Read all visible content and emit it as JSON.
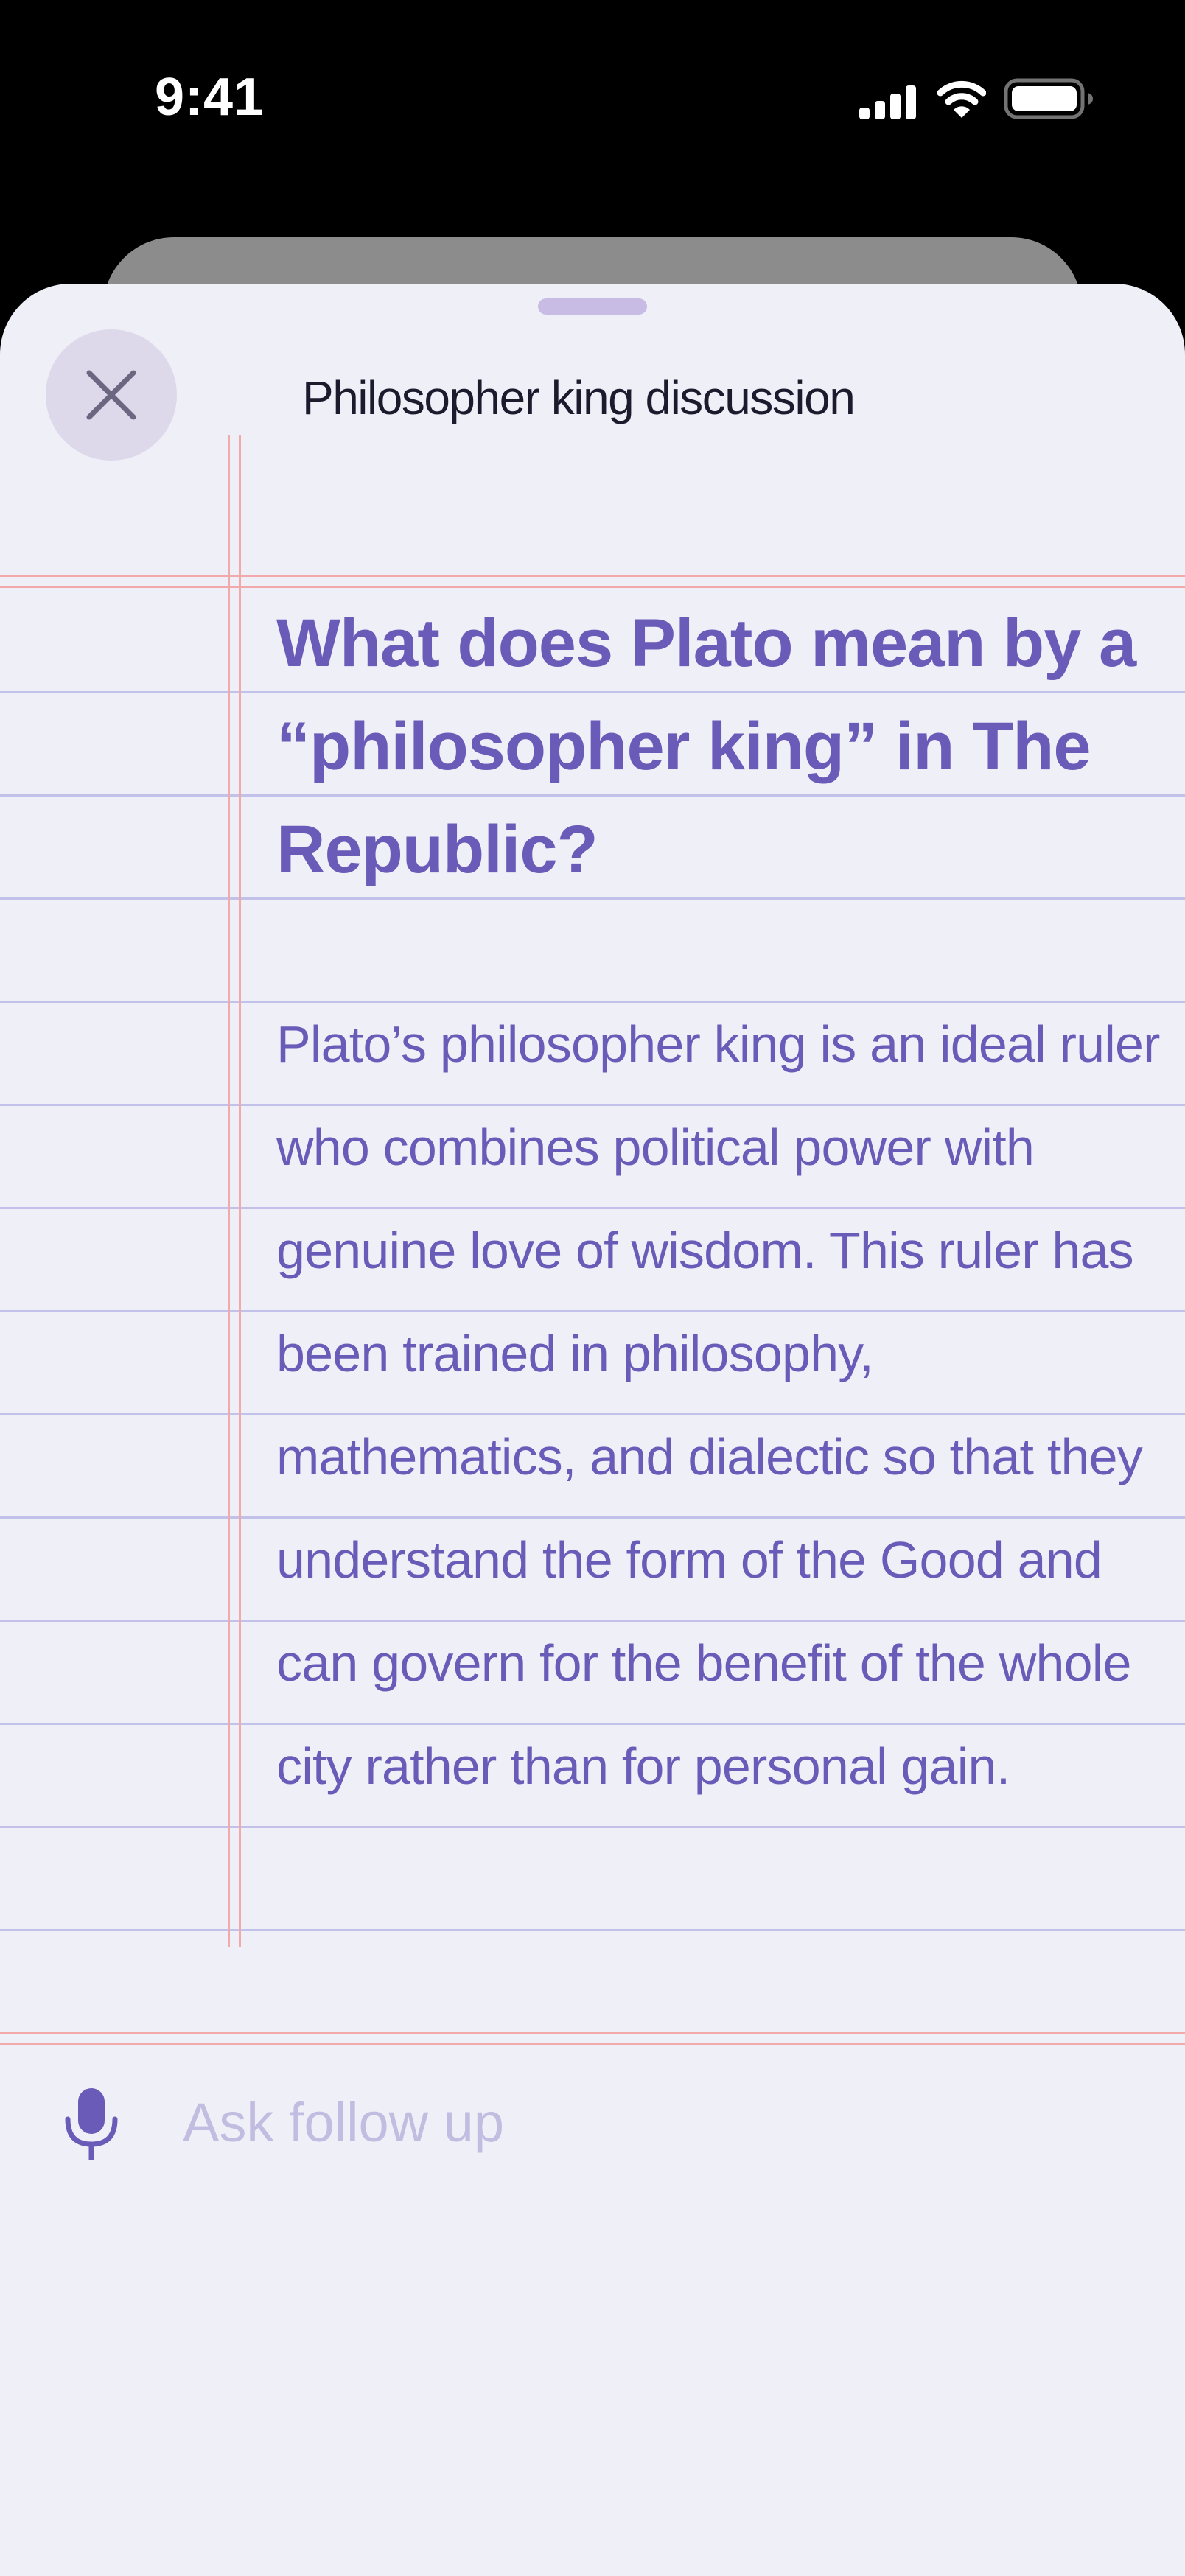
{
  "status_bar": {
    "time": "9:41",
    "icons": [
      "cellular-signal-icon",
      "wifi-icon",
      "battery-icon"
    ]
  },
  "sheet": {
    "title": "Philosopher king discussion",
    "close_icon": "close-icon"
  },
  "conversation": {
    "question": "What does Plato mean by a “philosopher king” in The Republic?",
    "answer": "Plato’s philosopher king is an ideal ruler who combines political power with genuine love of wisdom. This ruler has been trained in philosophy, mathematics, and dialectic so that they understand the form of the Good and can govern for the benefit of the whole city rather than for personal gain."
  },
  "follow_up": {
    "placeholder": "Ask follow up",
    "value": "",
    "mic_icon": "microphone-icon"
  },
  "colors": {
    "accent": "#6a5bb8",
    "sheet_background": "#efeff8",
    "ruled_line": "#c1c1e9",
    "margin_line": "#f1a9aa",
    "placeholder": "#c2bce0"
  }
}
